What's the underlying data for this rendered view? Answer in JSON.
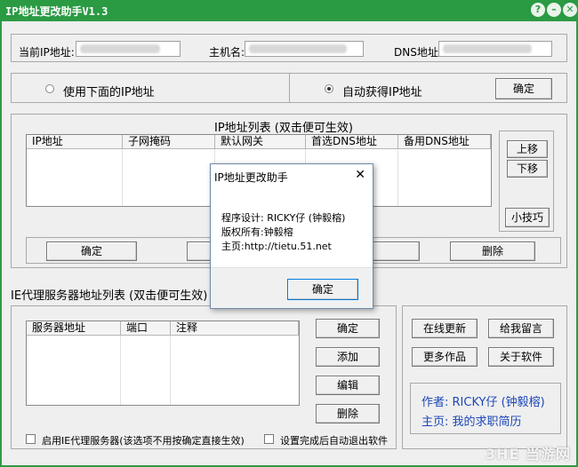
{
  "window": {
    "title": "IP地址更改助手V1.3",
    "help_btn": "?",
    "min_btn": "–",
    "close_btn": "✕"
  },
  "top": {
    "current_ip_label": "当前IP地址:",
    "hostname_label": "主机名:",
    "dns_label": "DNS地址:"
  },
  "mode": {
    "use_below": "使用下面的IP地址",
    "auto_obtain": "自动获得IP地址",
    "selected": "auto_obtain",
    "confirm": "确定"
  },
  "ip_list": {
    "title": "IP地址列表 (双击便可生效)",
    "columns": [
      "IP地址",
      "子网掩码",
      "默认网关",
      "首选DNS地址",
      "备用DNS地址"
    ],
    "rows": [],
    "up": "上移",
    "down": "下移",
    "tips": "小技巧",
    "confirm": "确定",
    "delete": "删除"
  },
  "proxy": {
    "title": "IE代理服务器地址列表 (双击便可生效)",
    "columns": [
      "服务器地址",
      "端口",
      "注释"
    ],
    "rows": [],
    "confirm": "确定",
    "add": "添加",
    "edit": "编辑",
    "delete": "删除",
    "enable_proxy": "启用IE代理服务器(该选项不用按确定直接生效)",
    "auto_exit": "设置完成后自动退出软件"
  },
  "side": {
    "online_update": "在线更新",
    "leave_message": "给我留言",
    "more_works": "更多作品",
    "about": "关于软件",
    "author": "作者: RICKY仔 (钟毅榕)",
    "homepage": "主页: 我的求职简历"
  },
  "dialog": {
    "title": "IP地址更改助手",
    "close": "✕",
    "line1": "程序设计: RICKY仔 (钟毅榕)",
    "line2": "版权所有:钟毅榕",
    "line3": "主页:http://tietu.51.net",
    "ok": "确定"
  },
  "watermark": "3HE 当游网",
  "colors": {
    "title_bar": "#2a9a43",
    "author_text": "#1c47b8"
  }
}
